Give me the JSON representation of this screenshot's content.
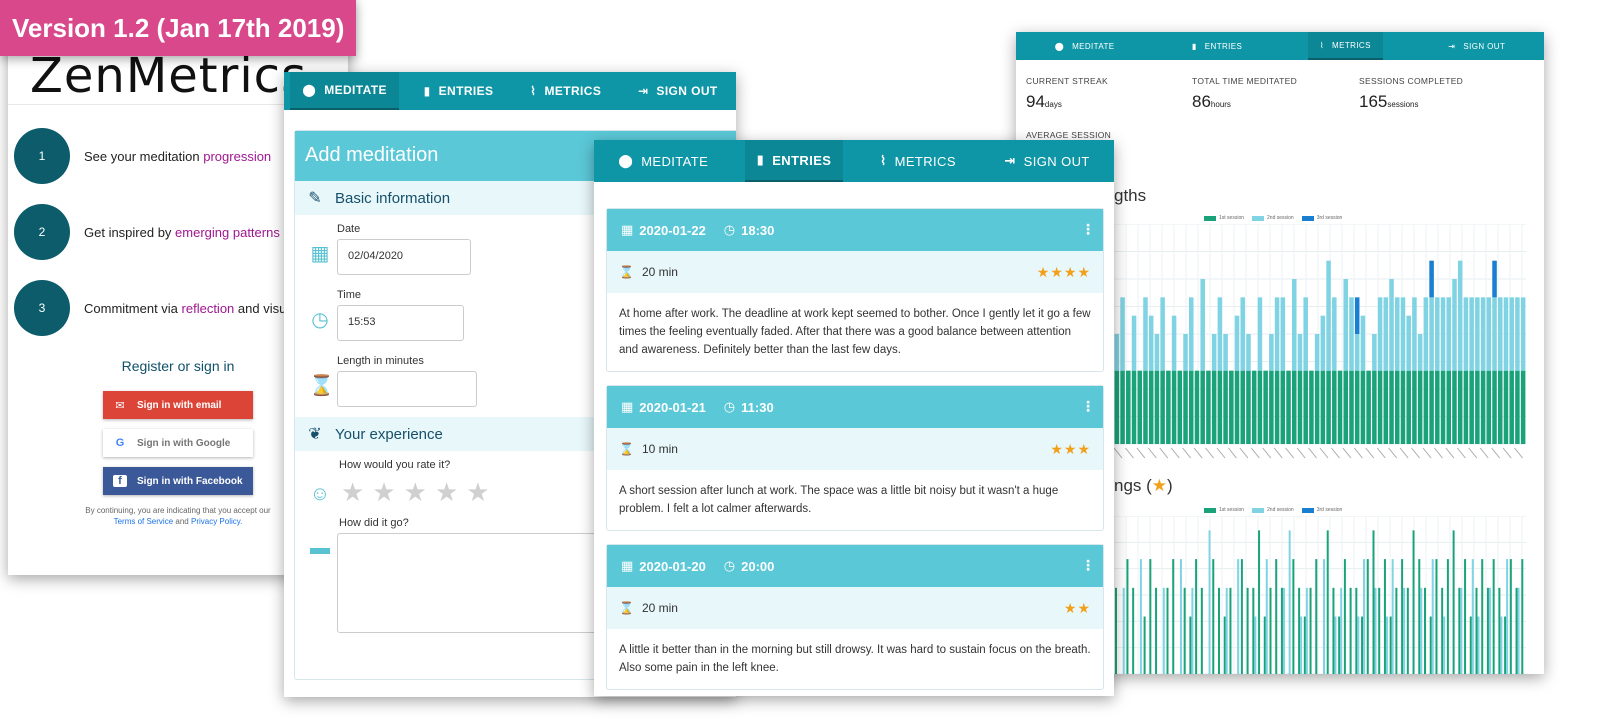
{
  "banner": "Version 1.2 (Jan 17th 2019)",
  "colors": {
    "accent": "#0f96a6",
    "light_accent": "#5bc8d7",
    "banner": "#d9488b",
    "session1": "#1aa37a",
    "session2": "#7fd3e3",
    "session3": "#1b7fd1"
  },
  "signin": {
    "logo": "ZenMetrics",
    "features": [
      {
        "num": "1",
        "text": "See your meditation ",
        "highlight": "progression",
        "rest": ""
      },
      {
        "num": "2",
        "text": "Get inspired by ",
        "highlight": "emerging patterns",
        "rest": ""
      },
      {
        "num": "3",
        "text": "Commitment via ",
        "highlight": "reflection",
        "rest": " and visu"
      }
    ],
    "register": "Register or sign in",
    "email_btn": "Sign in with email",
    "google_btn": "Sign in with Google",
    "facebook_btn": "Sign in with Facebook",
    "legal_1": "By continuing, you are indicating that you accept our",
    "terms": "Terms of Service",
    "and": "and",
    "privacy": "Privacy Policy."
  },
  "nav": {
    "meditate": "MEDITATE",
    "entries": "ENTRIES",
    "metrics": "METRICS",
    "signout": "SIGN OUT"
  },
  "addmed": {
    "title": "Add meditation",
    "basic": "Basic information",
    "date_label": "Date",
    "date_value": "02/04/2020",
    "time_label": "Time",
    "time_value": "15:53",
    "length_label": "Length in minutes",
    "length_value": "",
    "experience": "Your experience",
    "rate_label": "How would you rate it?",
    "how_label": "How did it go?"
  },
  "entries": [
    {
      "date": "2020-01-22",
      "time": "18:30",
      "length": "20 min",
      "rating": 4,
      "text": "At home after work. The deadline at work kept seemed to bother. Once I gently let it go a few times the feeling eventually faded. After that there was a good balance between attention and awareness. Definitely better than the last few days."
    },
    {
      "date": "2020-01-21",
      "time": "11:30",
      "length": "10 min",
      "rating": 3,
      "text": "A short session after lunch at work. The space was a little bit noisy but it wasn't a huge problem. I felt a lot calmer afterwards."
    },
    {
      "date": "2020-01-20",
      "time": "20:00",
      "length": "20 min",
      "rating": 2,
      "text": "A little it better than in the morning but still drowsy. It was hard to sustain focus on the breath. Also some pain in the left knee."
    }
  ],
  "metrics": {
    "streak_label": "CURRENT STREAK",
    "streak_value": "94",
    "streak_unit": "days",
    "total_label": "TOTAL TIME MEDITATED",
    "total_value": "86",
    "total_unit": "hours",
    "sessions_label": "SESSIONS COMPLETED",
    "sessions_value": "165",
    "sessions_unit": "sessions",
    "avg_label": "AVERAGE SESSION",
    "chart1_title_fragment": "gths",
    "chart2_title_fragment": "ngs (",
    "chart2_title_close": ")",
    "legend": [
      "1st session",
      "2nd session",
      "3rd session"
    ]
  },
  "chart_data": [
    {
      "type": "bar",
      "stacked": true,
      "title": "",
      "series": [
        {
          "name": "1st session",
          "values": [
            20,
            20,
            20,
            20,
            20,
            20,
            20,
            20,
            20,
            20,
            20,
            20,
            20,
            20,
            20,
            20,
            20,
            20,
            20,
            20,
            20,
            20,
            20,
            20,
            20,
            20,
            20,
            20,
            20,
            20,
            20,
            20,
            20,
            20,
            20,
            20,
            20,
            20,
            20,
            20,
            20,
            20,
            20,
            20,
            20,
            20,
            20,
            20,
            20,
            20,
            20,
            20,
            20,
            20,
            20,
            20,
            20,
            20,
            20,
            20,
            20,
            20,
            20,
            20,
            20,
            20,
            20,
            20,
            20,
            20,
            20,
            20
          ]
        },
        {
          "name": "2nd session",
          "values": [
            10,
            20,
            0,
            15,
            0,
            20,
            15,
            10,
            20,
            0,
            15,
            0,
            10,
            20,
            0,
            25,
            0,
            10,
            20,
            10,
            0,
            15,
            20,
            10,
            0,
            20,
            0,
            10,
            20,
            20,
            0,
            25,
            10,
            20,
            0,
            10,
            15,
            30,
            20,
            0,
            25,
            20,
            10,
            15,
            0,
            10,
            20,
            20,
            25,
            20,
            20,
            15,
            20,
            10,
            20,
            20,
            20,
            20,
            20,
            25,
            30,
            20,
            20,
            20,
            20,
            20,
            20,
            20,
            20,
            20,
            20,
            20
          ]
        },
        {
          "name": "3rd session",
          "values": [
            0,
            0,
            0,
            0,
            0,
            0,
            0,
            0,
            0,
            0,
            0,
            0,
            0,
            0,
            0,
            0,
            0,
            0,
            0,
            0,
            0,
            0,
            0,
            0,
            0,
            0,
            0,
            0,
            0,
            0,
            0,
            0,
            0,
            0,
            0,
            0,
            0,
            0,
            0,
            0,
            0,
            0,
            10,
            0,
            0,
            0,
            0,
            0,
            0,
            0,
            0,
            0,
            0,
            0,
            0,
            10,
            0,
            0,
            0,
            0,
            0,
            0,
            0,
            0,
            0,
            0,
            10,
            0,
            0,
            0,
            0,
            0
          ]
        }
      ]
    },
    {
      "type": "bar",
      "title": "",
      "series": [
        {
          "name": "1st session",
          "values": [
            3,
            0,
            4,
            3,
            0,
            2,
            4,
            3,
            0,
            3,
            4,
            0,
            3,
            2,
            4,
            3,
            0,
            4,
            3,
            2,
            3,
            0,
            4,
            3,
            3,
            5,
            2,
            3,
            4,
            3,
            0,
            4,
            3,
            2,
            3,
            4,
            0,
            5,
            3,
            2,
            4,
            3,
            3,
            2,
            4,
            5,
            3,
            4,
            2,
            3,
            4,
            3,
            5,
            4,
            3,
            2,
            4,
            3,
            4,
            5,
            3,
            4,
            2,
            3,
            4,
            3,
            4,
            3,
            2,
            4,
            3,
            4
          ]
        },
        {
          "name": "2nd session",
          "values": [
            0,
            3,
            0,
            0,
            4,
            0,
            0,
            0,
            3,
            0,
            0,
            4,
            0,
            3,
            0,
            0,
            5,
            0,
            0,
            3,
            0,
            4,
            0,
            0,
            2,
            0,
            4,
            0,
            0,
            3,
            5,
            0,
            2,
            3,
            0,
            0,
            4,
            0,
            2,
            3,
            0,
            0,
            2,
            4,
            0,
            3,
            0,
            2,
            4,
            0,
            3,
            0,
            0,
            3,
            0,
            4,
            0,
            2,
            0,
            0,
            3,
            0,
            4,
            2,
            0,
            3,
            0,
            2,
            4,
            0,
            3,
            0
          ]
        }
      ]
    }
  ]
}
